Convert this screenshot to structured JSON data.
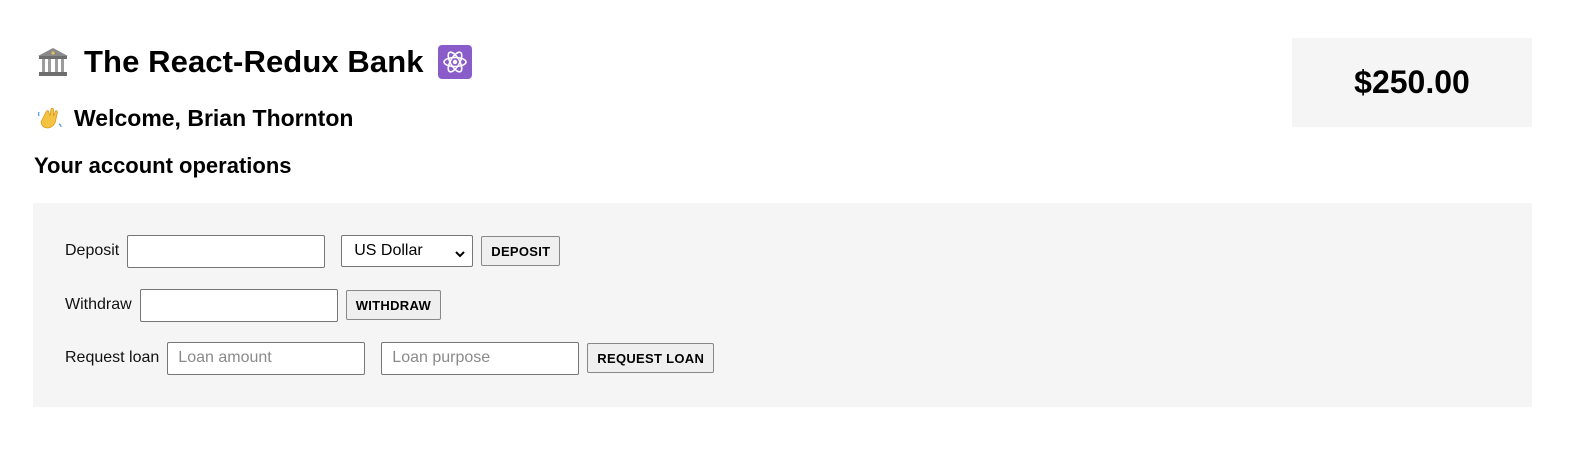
{
  "header": {
    "title": "The React-Redux Bank",
    "welcome": "Welcome, Brian Thornton",
    "icons": {
      "bank": "bank-building-icon",
      "react": "react-atom-icon",
      "wave": "waving-hand-icon"
    },
    "colors": {
      "react_icon_bg": "#8a5cc9"
    }
  },
  "balance": {
    "amount": "$250.00"
  },
  "operations": {
    "section_title": "Your account operations",
    "deposit": {
      "label": "Deposit",
      "value": "",
      "currency_selected": "US Dollar",
      "button_label": "DEPOSIT"
    },
    "withdraw": {
      "label": "Withdraw",
      "value": "",
      "button_label": "WITHDRAW"
    },
    "loan": {
      "label": "Request loan",
      "amount_placeholder": "Loan amount",
      "purpose_placeholder": "Loan purpose",
      "button_label": "REQUEST LOAN"
    },
    "colors": {
      "panel_bg": "#f5f5f5"
    }
  }
}
